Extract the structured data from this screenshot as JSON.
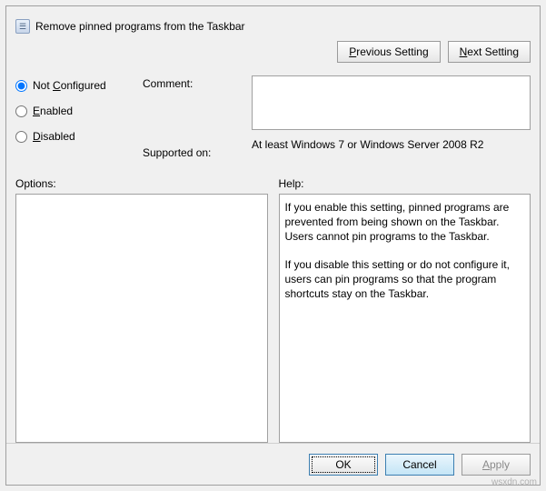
{
  "title": "Remove pinned programs from the Taskbar",
  "nav": {
    "previous_pre": "",
    "previous_u": "P",
    "previous_post": "revious Setting",
    "next_pre": "",
    "next_u": "N",
    "next_post": "ext Setting"
  },
  "state": {
    "not_pre": "Not ",
    "not_u": "C",
    "not_post": "onfigured",
    "en_u": "E",
    "en_post": "nabled",
    "dis_u": "D",
    "dis_post": "isabled",
    "selected": "not_configured"
  },
  "labels": {
    "comment": "Comment:",
    "supported_on": "Supported on:",
    "options": "Options:",
    "help": "Help:"
  },
  "comment_value": "",
  "supported_text": "At least Windows 7 or Windows Server 2008 R2",
  "help": {
    "p1": "If you enable this setting, pinned programs are prevented from being shown on the Taskbar. Users cannot pin programs to the Taskbar.",
    "p2": "If you disable this setting or do not configure it, users can pin programs so that the program shortcuts stay on the Taskbar."
  },
  "footer": {
    "ok": "OK",
    "cancel": "Cancel",
    "apply_u": "A",
    "apply_post": "pply"
  },
  "watermark": "wsxdn.com"
}
